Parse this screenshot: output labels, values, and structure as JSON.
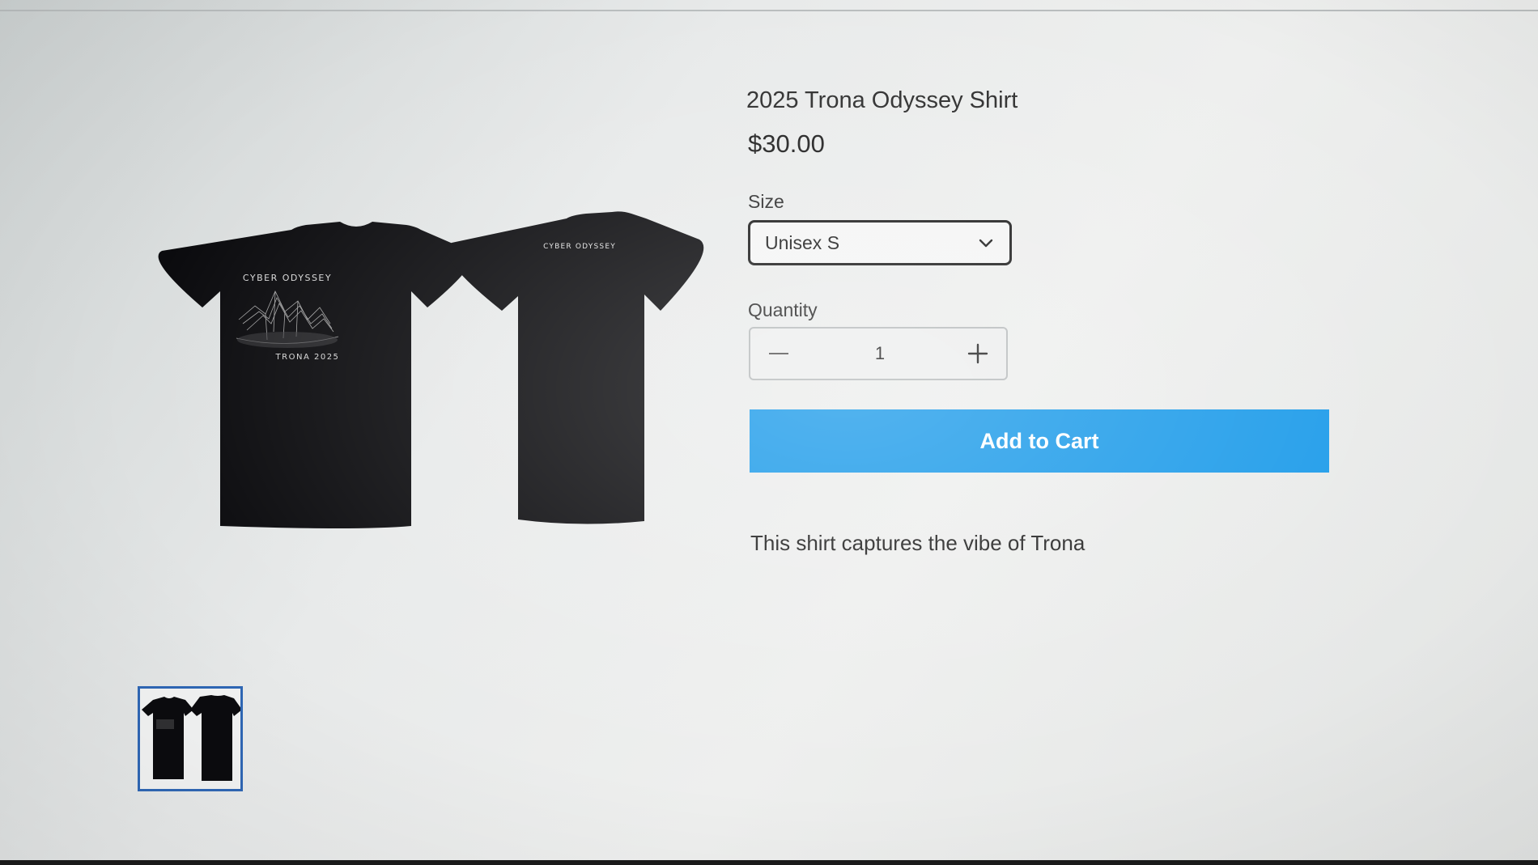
{
  "product": {
    "title": "2025 Trona Odyssey Shirt",
    "price": "$30.00",
    "description": "This shirt captures the vibe of Trona"
  },
  "size": {
    "label": "Size",
    "selected": "Unisex S"
  },
  "quantity": {
    "label": "Quantity",
    "value": "1"
  },
  "cart": {
    "button_label": "Add to Cart"
  },
  "shirt_print": {
    "front_top": "CYBER ODYSSEY",
    "front_bottom": "TRONA 2025",
    "back_top": "CYBER ODYSSEY"
  },
  "colors": {
    "accent": "#1a9ae9",
    "thumb_border": "#2f67b5",
    "shirt": "#0b0b0e"
  },
  "icons": {
    "size_dropdown": "chevron-down-icon",
    "qty_decrease": "minus-icon",
    "qty_increase": "plus-icon"
  }
}
